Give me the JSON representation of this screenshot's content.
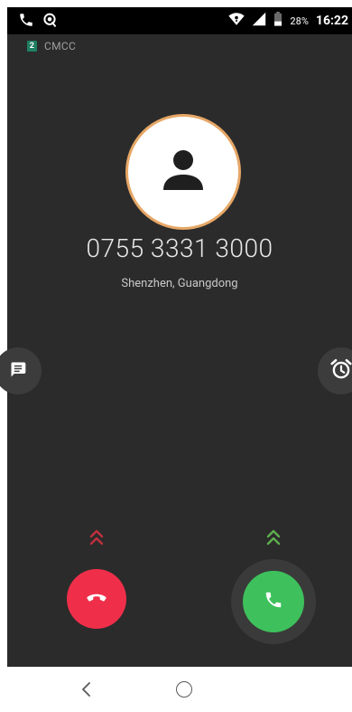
{
  "status_bar": {
    "battery_percent": "28%",
    "time": "16:22",
    "icons": [
      "phone-icon",
      "location-icon",
      "wifi-icon",
      "signal-icon",
      "battery-icon"
    ]
  },
  "carrier": {
    "sim_slot": "2",
    "name": "CMCC"
  },
  "caller": {
    "number": "0755 3331 3000",
    "location": "Shenzhen, Guangdong"
  },
  "actions": {
    "message_icon": "message-icon",
    "alarm_icon": "alarm-icon",
    "decline_icon": "hang-up-icon",
    "answer_icon": "phone-answer-icon"
  },
  "colors": {
    "background": "#2b2b2b",
    "decline": "#ef2f4a",
    "answer": "#3ec15c",
    "avatar_ring": "#e6a766"
  },
  "nav_bar": {
    "icons": [
      "back-icon",
      "home-icon"
    ]
  }
}
